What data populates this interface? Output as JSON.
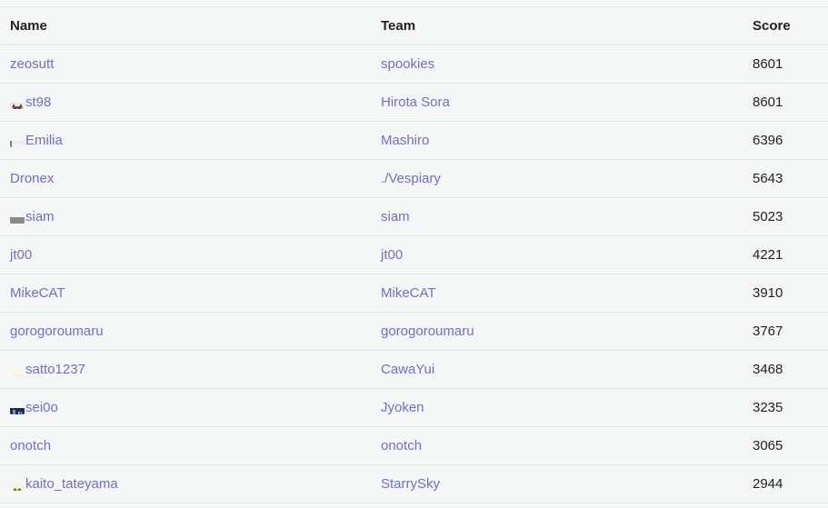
{
  "table": {
    "headers": {
      "name": "Name",
      "team": "Team",
      "score": "Score"
    },
    "rows": [
      {
        "name": "zeosutt",
        "team": "spookies",
        "score": "8601",
        "avatar": null
      },
      {
        "name": "st98",
        "team": "Hirota Sora",
        "score": "8601",
        "avatar": "cat-girl-avatar"
      },
      {
        "name": "Emilia",
        "team": "Mashiro",
        "score": "6396",
        "avatar": "white-haired-girl-avatar"
      },
      {
        "name": "Dronex",
        "team": "./Vespiary",
        "score": "5643",
        "avatar": null
      },
      {
        "name": "siam",
        "team": "siam",
        "score": "5023",
        "avatar": "landscape-avatar"
      },
      {
        "name": "jt00",
        "team": "jt00",
        "score": "4221",
        "avatar": null
      },
      {
        "name": "MikeCAT",
        "team": "MikeCAT",
        "score": "3910",
        "avatar": null
      },
      {
        "name": "gorogoroumaru",
        "team": "gorogoroumaru",
        "score": "3767",
        "avatar": null
      },
      {
        "name": "satto1237",
        "team": "CawaYui",
        "score": "3468",
        "avatar": "cake-avatar"
      },
      {
        "name": "sei0o",
        "team": "Jyoken",
        "score": "3235",
        "avatar": "dark-blue-avatar"
      },
      {
        "name": "onotch",
        "team": "onotch",
        "score": "3065",
        "avatar": null
      },
      {
        "name": "kaito_tateyama",
        "team": "StarrySky",
        "score": "2944",
        "avatar": "frog-avatar"
      }
    ]
  },
  "colors": {
    "background": "#f4f7f6",
    "link": "#6c6fcf",
    "border": "#dfe4e3",
    "text": "#222222"
  }
}
